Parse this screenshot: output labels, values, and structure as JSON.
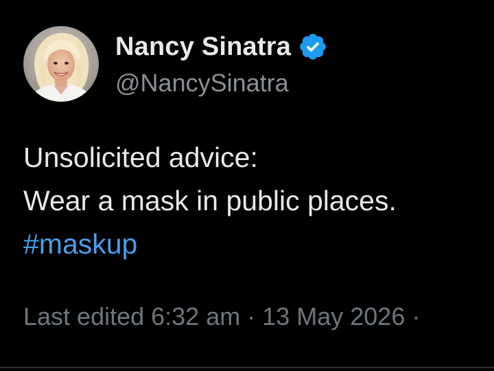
{
  "author": {
    "display_name": "Nancy Sinatra",
    "handle": "@NancySinatra",
    "verified": true,
    "avatar_icon": "profile-photo"
  },
  "tweet": {
    "lines": [
      "Unsolicited advice:",
      "Wear a mask in public places."
    ],
    "hashtag": "#maskup"
  },
  "meta": {
    "edited_label": "Last edited 6:32 am · 13 May 2026 ·"
  },
  "colors": {
    "background": "#000000",
    "primary_text": "#e7e9ea",
    "secondary_text": "#8b9096",
    "link": "#4a9eea",
    "verified_badge": "#1d9bf0"
  }
}
